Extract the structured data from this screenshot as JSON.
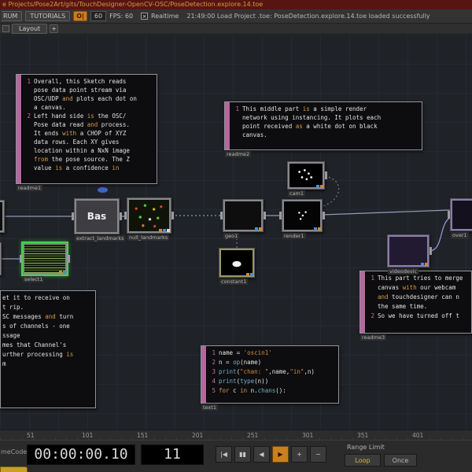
{
  "titlebar": {
    "path": "e Projects/Pose2Art/gits/TouchDesigner-OpenCV-OSC/PoseDetection.explore.14.toe"
  },
  "menubar": {
    "forum": "RUM",
    "tutorials": "TUTORIALS",
    "toggle": "O|",
    "fps_box": "60",
    "fps_label": "FPS: 60",
    "realtime_check": "×",
    "realtime": "Realtime",
    "status": "21:49:00 Load Project .toe: PoseDetection.explore.14.toe loaded successfully"
  },
  "tabs": {
    "layout": "Layout",
    "add": "+"
  },
  "canvas": {
    "comments": {
      "readme1": {
        "label": "readme1",
        "lines": [
          {
            "n": "1",
            "t": "Overall, this Sketch reads"
          },
          {
            "t": "pose data point stream via"
          },
          {
            "t": "OSC/UDP and plots each dot on"
          },
          {
            "t": "a canvas."
          },
          {
            "n": "2",
            "t": "Left hand side is the OSC/"
          },
          {
            "t": "Pose data read and process."
          },
          {
            "t": "It ends with a CHOP of XYZ"
          },
          {
            "t": "data rows. Each XY gives"
          },
          {
            "t": "location within a NxN image"
          },
          {
            "t": "from the pose source. The Z"
          },
          {
            "t": "value is a confidence in"
          }
        ]
      },
      "readme2": {
        "label": "readme2",
        "lines": [
          {
            "n": "1",
            "t": "This middle part is a simple render"
          },
          {
            "t": "network using instancing. It plots each"
          },
          {
            "t": "point received as a white dot on black"
          },
          {
            "t": "canvas."
          }
        ]
      },
      "readme3": {
        "label": "readme3",
        "lines": [
          {
            "n": "1",
            "t": "This part tries to merge"
          },
          {
            "t": "canvas with our webcam"
          },
          {
            "t": "and touchdesigner can n"
          },
          {
            "t": "the same time."
          },
          {
            "n": "2",
            "t": "So we have turned off t"
          }
        ]
      },
      "osc_note": {
        "lines": [
          {
            "t": "et it to receive on"
          },
          {
            "t": "t rip."
          },
          {
            "t": "SC messages and turn"
          },
          {
            "t": "s of channels - one"
          },
          {
            "t": "ssage"
          },
          {
            "t": "mes that Channel's"
          },
          {
            "t": "urther processing is"
          },
          {
            "t": "m"
          }
        ]
      },
      "text1": {
        "label": "text1",
        "lines": [
          {
            "n": "1",
            "t": "name = 'oscin1'"
          },
          {
            "n": "2",
            "t": "n = op(name)"
          },
          {
            "n": "3",
            "t": "print(\"chan: \",name,\"in\",n)"
          },
          {
            "n": "4",
            "t": "print(type(n))"
          },
          {
            "n": "5",
            "t": "for c in n.chans():"
          }
        ]
      }
    },
    "operators": {
      "select1": "select1",
      "base": "Bas",
      "base_label": "extract_landmarks",
      "null": "null_landmarks",
      "geo": "geo1",
      "cam": "cam1",
      "render": "render1",
      "constant": "constant1",
      "video": "videodevic",
      "over": "over1"
    }
  },
  "ruler": {
    "ticks": [
      "51",
      "101",
      "151",
      "201",
      "251",
      "301",
      "351",
      "401"
    ]
  },
  "transport": {
    "label_left": "meCode",
    "timecode": "00:00:00.10",
    "frame": "11",
    "buttons": [
      {
        "g": "|◀",
        "name": "jump-to-start"
      },
      {
        "g": "▮▮",
        "name": "pause"
      },
      {
        "g": "◀",
        "name": "play-reverse"
      },
      {
        "g": "▶",
        "name": "play-forward",
        "active": true
      },
      {
        "g": "+",
        "name": "step-forward"
      },
      {
        "g": "−",
        "name": "step-back"
      }
    ],
    "range_limit": "Range Limit",
    "loop": "Loop",
    "once": "Once"
  },
  "colors": {
    "accent_orange": "#cf7a1f",
    "selected_green": "#46d24c",
    "dat_pink": "#b2689e",
    "play_active": "#c8811e"
  }
}
